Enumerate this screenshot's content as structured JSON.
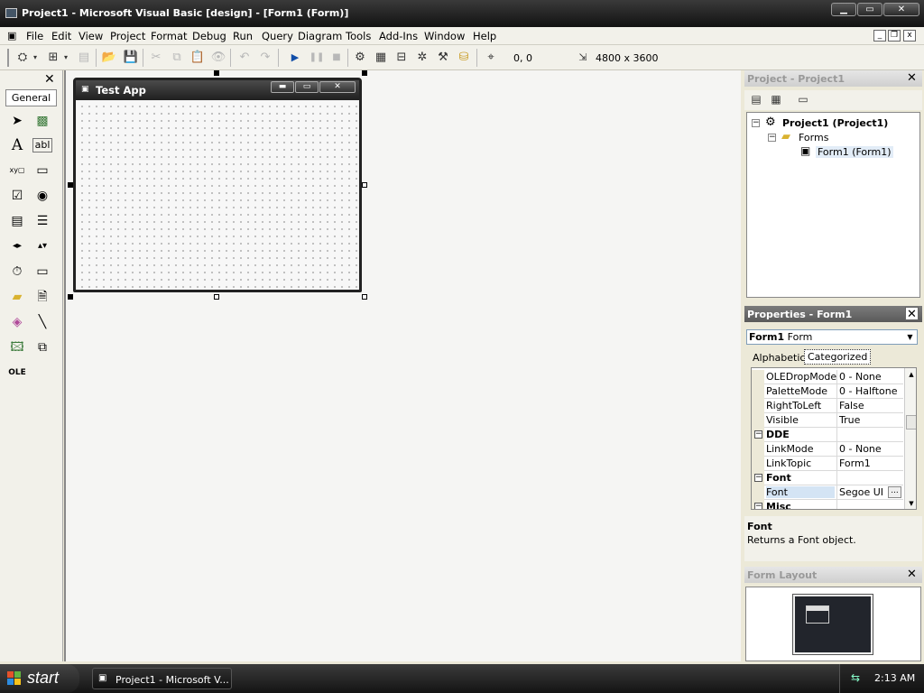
{
  "window": {
    "title": "Project1 - Microsoft Visual Basic [design] - [Form1 (Form)]",
    "controls": {
      "minimize": "▁",
      "maximize": "▭",
      "close": "✕"
    }
  },
  "menubar": {
    "items": [
      "File",
      "Edit",
      "View",
      "Project",
      "Format",
      "Debug",
      "Run",
      "Query",
      "Diagram",
      "Tools",
      "Add-Ins",
      "Window",
      "Help"
    ],
    "mdi_controls": {
      "minimize": "_",
      "restore": "❐",
      "close": "x"
    }
  },
  "toolbar": {
    "position": "0, 0",
    "size": "4800 x 3600",
    "icons": [
      "add-project-icon",
      "add-form-icon",
      "menu-editor-icon",
      "open-icon",
      "save-icon",
      "cut-icon",
      "copy-icon",
      "paste-icon",
      "find-icon",
      "undo-icon",
      "redo-icon",
      "start-icon",
      "break-icon",
      "end-icon",
      "project-explorer-icon",
      "properties-window-icon",
      "form-layout-icon",
      "object-browser-icon",
      "toolbox-icon",
      "data-view-icon",
      "visual-component-manager-icon"
    ]
  },
  "toolbox": {
    "close": "✕",
    "tab": "General",
    "tools": [
      "pointer",
      "picturebox",
      "label",
      "textbox",
      "frame",
      "commandbutton",
      "checkbox",
      "optionbutton",
      "combobox",
      "listbox",
      "hscrollbar",
      "vscrollbar",
      "timer",
      "drivelistbox",
      "dirlistbox",
      "filelistbox",
      "shape",
      "line",
      "image",
      "data",
      "ole"
    ]
  },
  "form": {
    "title": "Test App",
    "controls": {
      "minimize": "▬",
      "maximize": "▭",
      "close": "✕"
    }
  },
  "project_explorer": {
    "title": "Project - Project1",
    "close": "✕",
    "tree": {
      "root": "Project1 (Project1)",
      "folder": "Forms",
      "item": "Form1 (Form1)"
    }
  },
  "properties": {
    "title": "Properties - Form1",
    "close": "✕",
    "object_name": "Form1",
    "object_type": "Form",
    "tabs": [
      "Alphabetic",
      "Categorized"
    ],
    "selected_tab": "Categorized",
    "rows": [
      {
        "name": "OLEDropMode",
        "value": "0 - None"
      },
      {
        "name": "PaletteMode",
        "value": "0 - Halftone"
      },
      {
        "name": "RightToLeft",
        "value": "False"
      },
      {
        "name": "Visible",
        "value": "True"
      },
      {
        "name": "DDE",
        "value": "",
        "category": true
      },
      {
        "name": "LinkMode",
        "value": "0 - None"
      },
      {
        "name": "LinkTopic",
        "value": "Form1"
      },
      {
        "name": "Font",
        "value": "",
        "category": true
      },
      {
        "name": "Font",
        "value": "Segoe UI",
        "selected": true,
        "ellipsis": "..."
      },
      {
        "name": "Misc",
        "value": "",
        "category": true
      }
    ],
    "description_title": "Font",
    "description_text": "Returns a Font object."
  },
  "form_layout": {
    "title": "Form Layout",
    "close": "✕"
  },
  "taskbar": {
    "start": "start",
    "task": "Project1 - Microsoft V...",
    "clock": "2:13 AM"
  }
}
